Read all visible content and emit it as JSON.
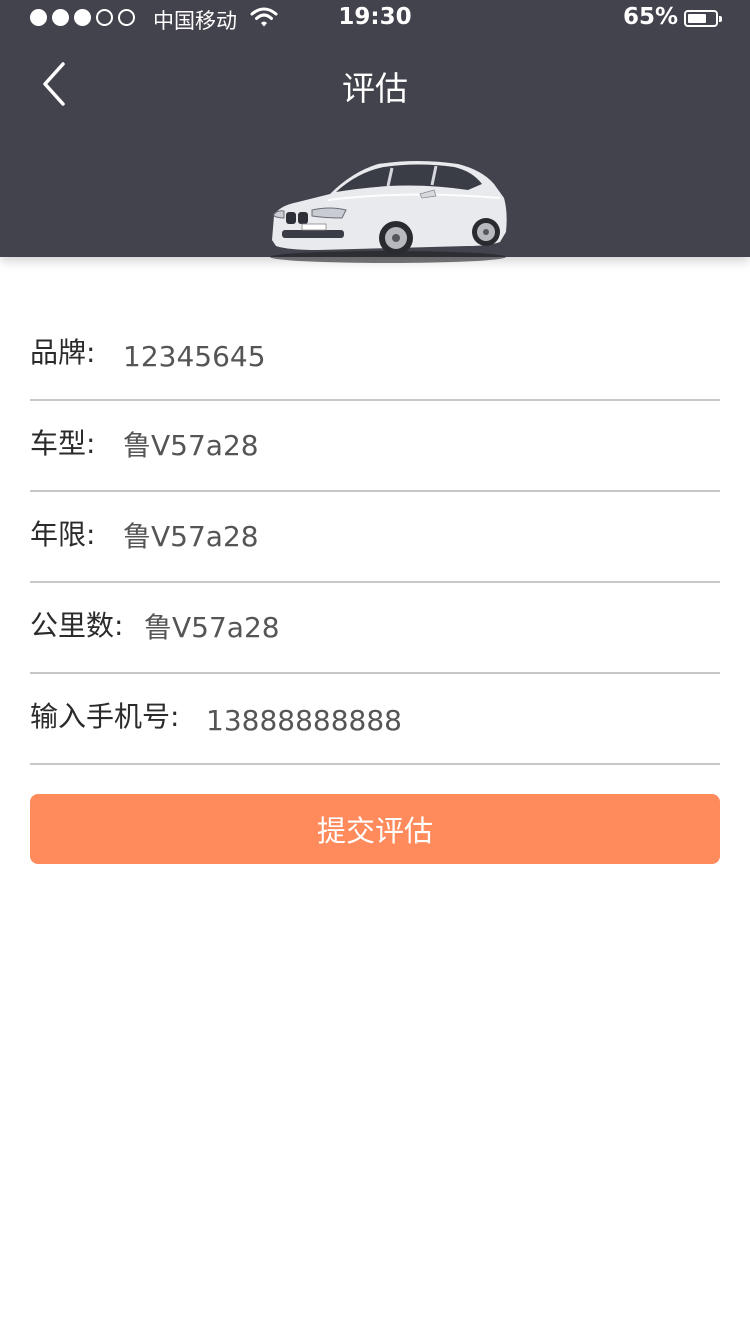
{
  "status_bar": {
    "carrier": "中国移动",
    "time": "19:30",
    "battery": "65%",
    "battery_level": 0.65,
    "signal_bars_filled": 3,
    "signal_bars_total": 5
  },
  "nav": {
    "title": "评估",
    "back_icon": "chevron-left-icon"
  },
  "car_image": "car-photo",
  "form": {
    "rows": [
      {
        "label": "品牌:",
        "value": "12345645"
      },
      {
        "label": "车型:",
        "value": "鲁V57a28"
      },
      {
        "label": "年限:",
        "value": "鲁V57a28"
      },
      {
        "label": "公里数:",
        "value": "鲁V57a28"
      },
      {
        "label": "输入手机号:",
        "value": "13888888888"
      }
    ]
  },
  "submit": {
    "label": "提交评估"
  },
  "colors": {
    "header": "#43434d",
    "accent": "#ff8a5b",
    "divider": "#c7c7c7"
  }
}
